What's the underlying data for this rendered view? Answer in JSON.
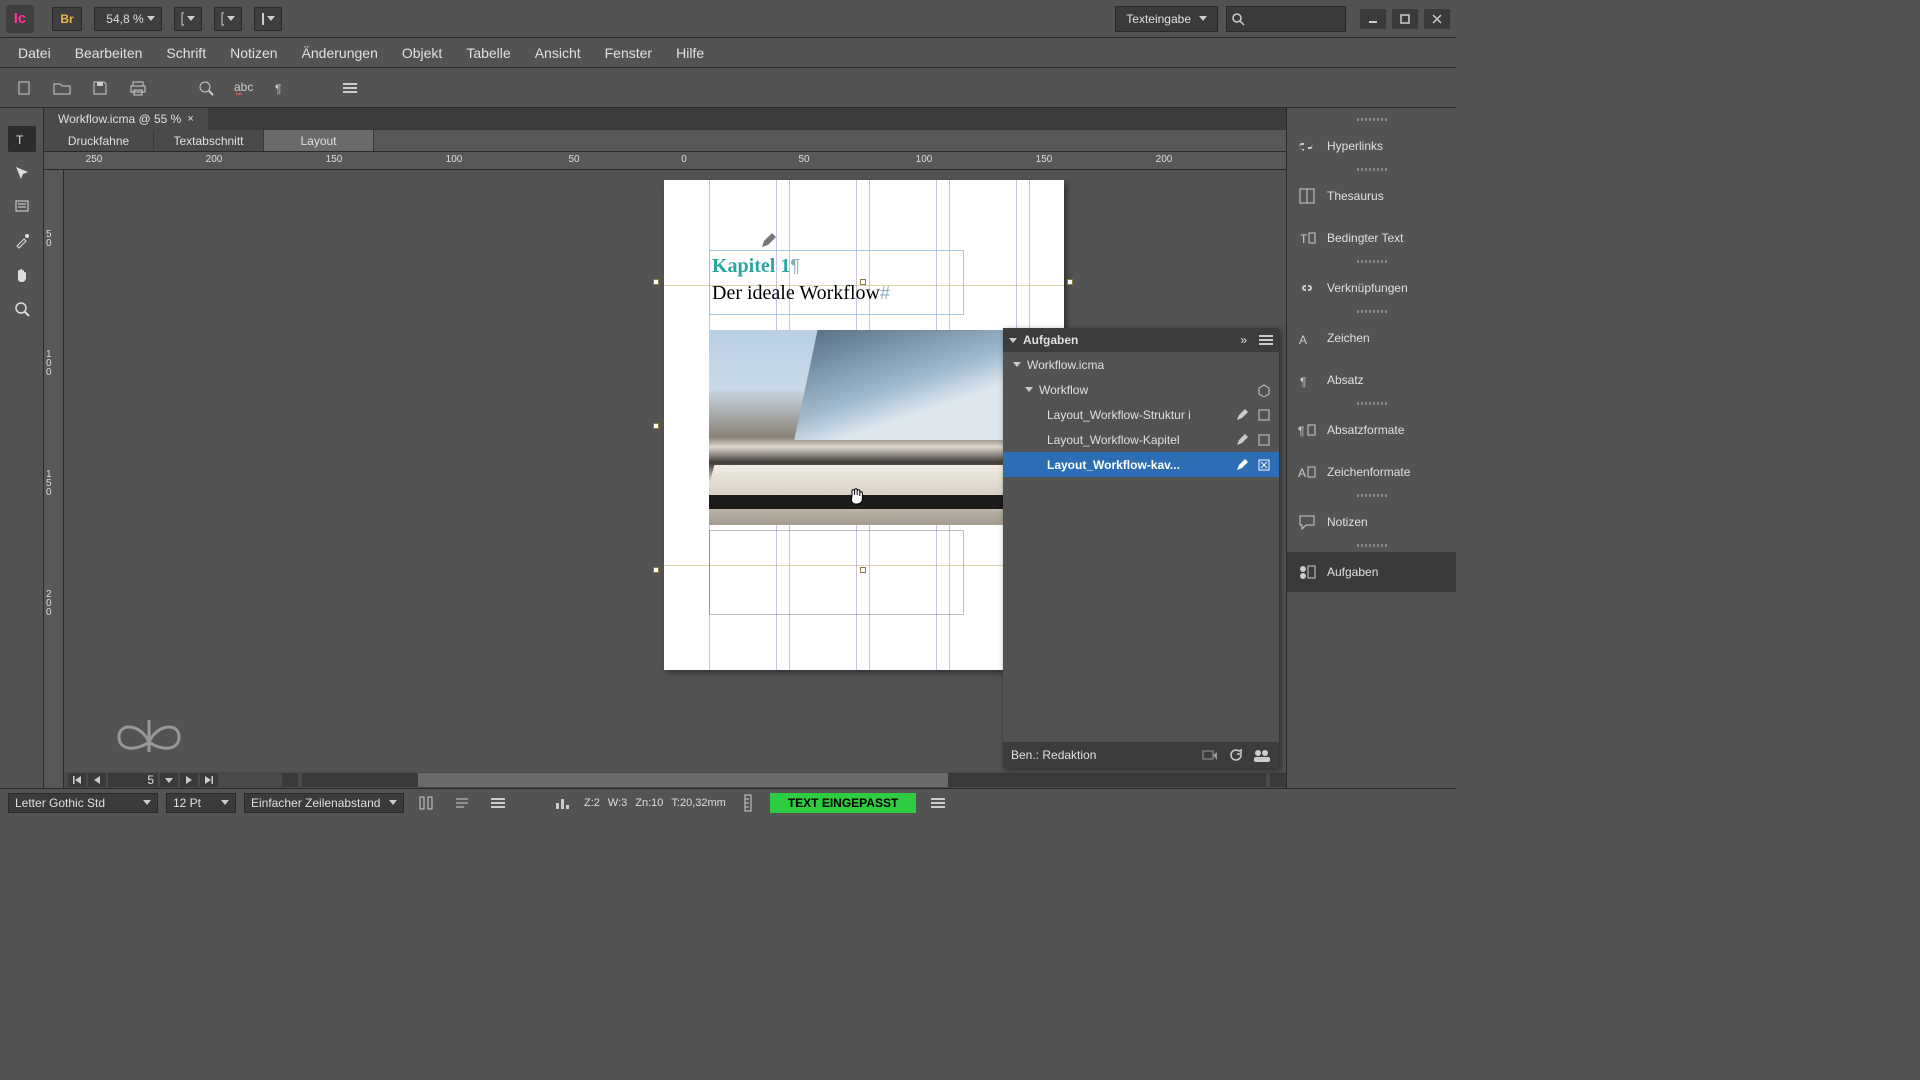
{
  "titlebar": {
    "app": "Ic",
    "bridge": "Br",
    "zoom": "54,8 %",
    "workspace": "Texteingabe"
  },
  "menu": [
    "Datei",
    "Bearbeiten",
    "Schrift",
    "Notizen",
    "Änderungen",
    "Objekt",
    "Tabelle",
    "Ansicht",
    "Fenster",
    "Hilfe"
  ],
  "doc_tab": {
    "title": "Workflow.icma @ 55 %"
  },
  "view_tabs": [
    "Druckfahne",
    "Textabschnitt",
    "Layout"
  ],
  "view_tab_active": 2,
  "ruler_h": [
    "250",
    "200",
    "150",
    "100",
    "50",
    "0",
    "50",
    "100",
    "150",
    "200"
  ],
  "ruler_v": [
    "50",
    "100",
    "150",
    "200"
  ],
  "page_text": {
    "kapitel": "Kapitel 1",
    "subtitle": "Der ideale Workflow"
  },
  "right_panels": [
    {
      "icon": "link-icon",
      "label": "Hyperlinks"
    },
    {
      "icon": "book-icon",
      "label": "Thesaurus"
    },
    {
      "icon": "cond-text-icon",
      "label": "Bedingter Text"
    },
    {
      "icon": "chain-icon",
      "label": "Verknüpfungen"
    },
    {
      "icon": "char-icon",
      "label": "Zeichen"
    },
    {
      "icon": "para-icon",
      "label": "Absatz"
    },
    {
      "icon": "para-style-icon",
      "label": "Absatzformate"
    },
    {
      "icon": "char-style-icon",
      "label": "Zeichenformate"
    },
    {
      "icon": "notes-icon",
      "label": "Notizen"
    },
    {
      "icon": "tasks-icon",
      "label": "Aufgaben"
    }
  ],
  "right_panel_active": 9,
  "aufgaben": {
    "title": "Aufgaben",
    "root": "Workflow.icma",
    "group": "Workflow",
    "items": [
      {
        "label": "Layout_Workflow-Struktur i",
        "sel": false,
        "box": true
      },
      {
        "label": "Layout_Workflow-Kapitel",
        "sel": false,
        "box": true
      },
      {
        "label": "Layout_Workflow-kav...",
        "sel": true,
        "box": false
      }
    ],
    "footer_user": "Ben.: Redaktion"
  },
  "nav": {
    "page": "5"
  },
  "status": {
    "font": "Letter Gothic Std",
    "size": "12 Pt",
    "leading": "Einfacher Zeilenabstand",
    "z": "Z:2",
    "w": "W:3",
    "zn": "Zn:10",
    "t": "T:20,32mm",
    "fit": "TEXT EINGEPASST"
  }
}
